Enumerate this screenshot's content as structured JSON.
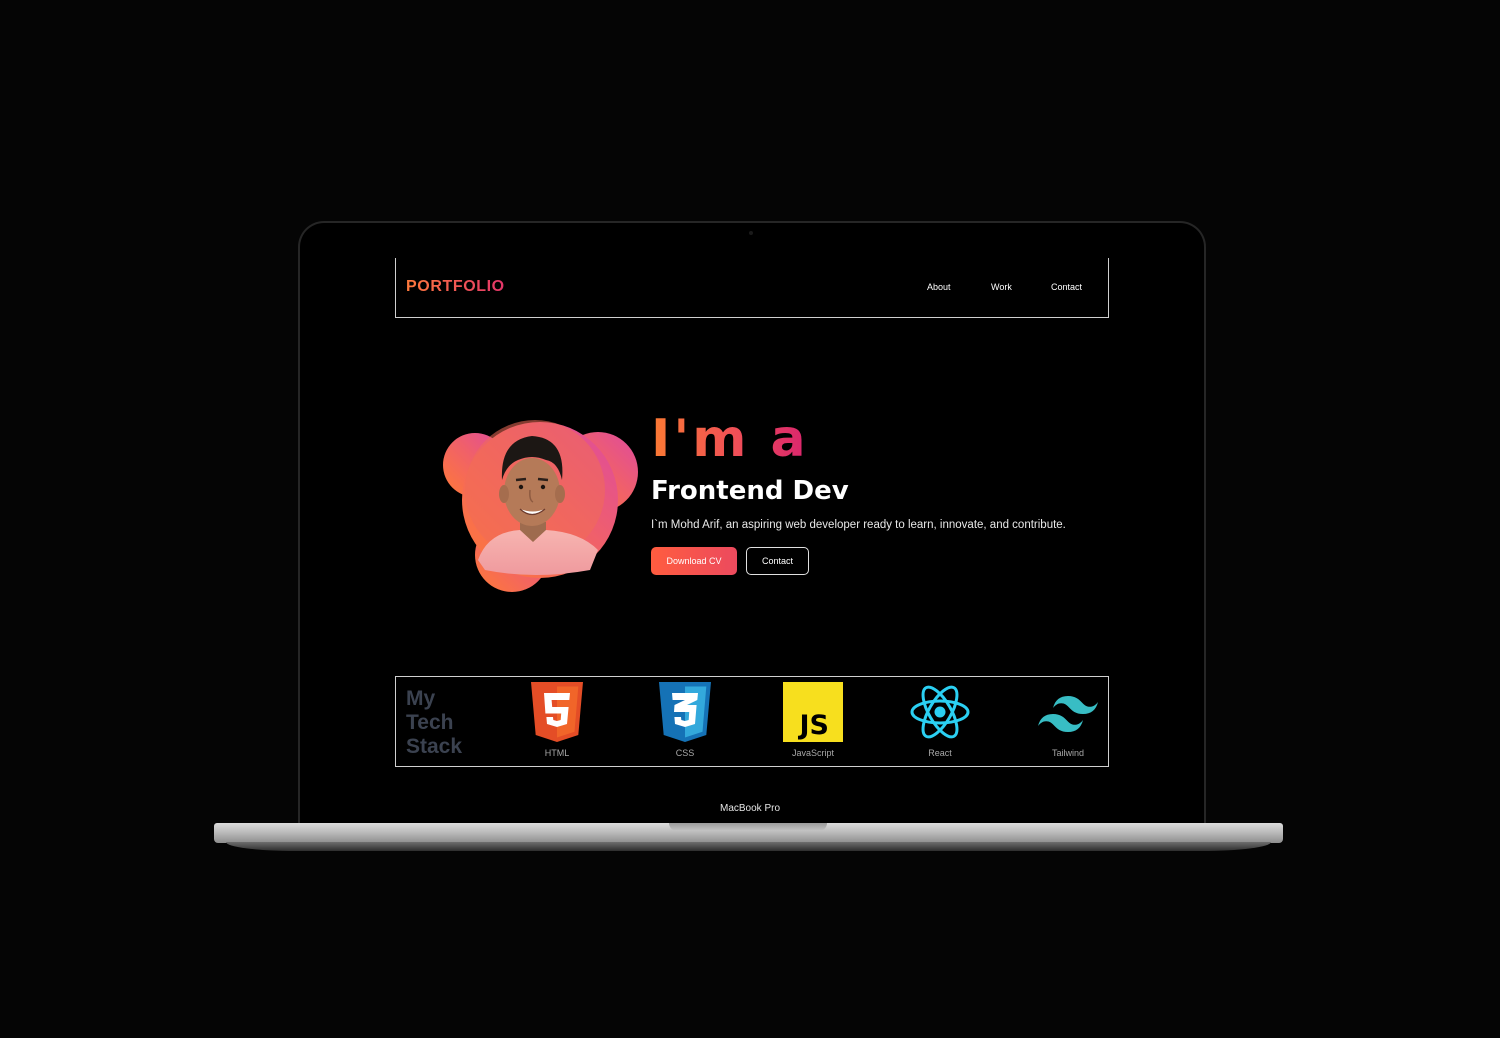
{
  "device": {
    "model_label": "MacBook Pro"
  },
  "navbar": {
    "logo": "PORTFOLIO",
    "links": [
      "About",
      "Work",
      "Contact"
    ]
  },
  "hero": {
    "title": "I'm a",
    "role": "Frontend Dev",
    "description": "I`m Mohd Arif, an aspiring web developer ready to learn, innovate, and contribute.",
    "primary_button": "Download CV",
    "secondary_button": "Contact"
  },
  "tech_stack": {
    "title_lines": [
      "My",
      "Tech",
      "Stack"
    ],
    "items": [
      {
        "label": "HTML",
        "icon": "html5-icon"
      },
      {
        "label": "CSS",
        "icon": "css3-icon"
      },
      {
        "label": "JavaScript",
        "icon": "javascript-icon"
      },
      {
        "label": "React",
        "icon": "react-icon"
      },
      {
        "label": "Tailwind",
        "icon": "tailwind-icon"
      }
    ]
  },
  "colors": {
    "background": "#000000",
    "accent_orange": "#ff7a3c",
    "accent_pink": "#e3356a",
    "stack_title": "#3b4250"
  }
}
